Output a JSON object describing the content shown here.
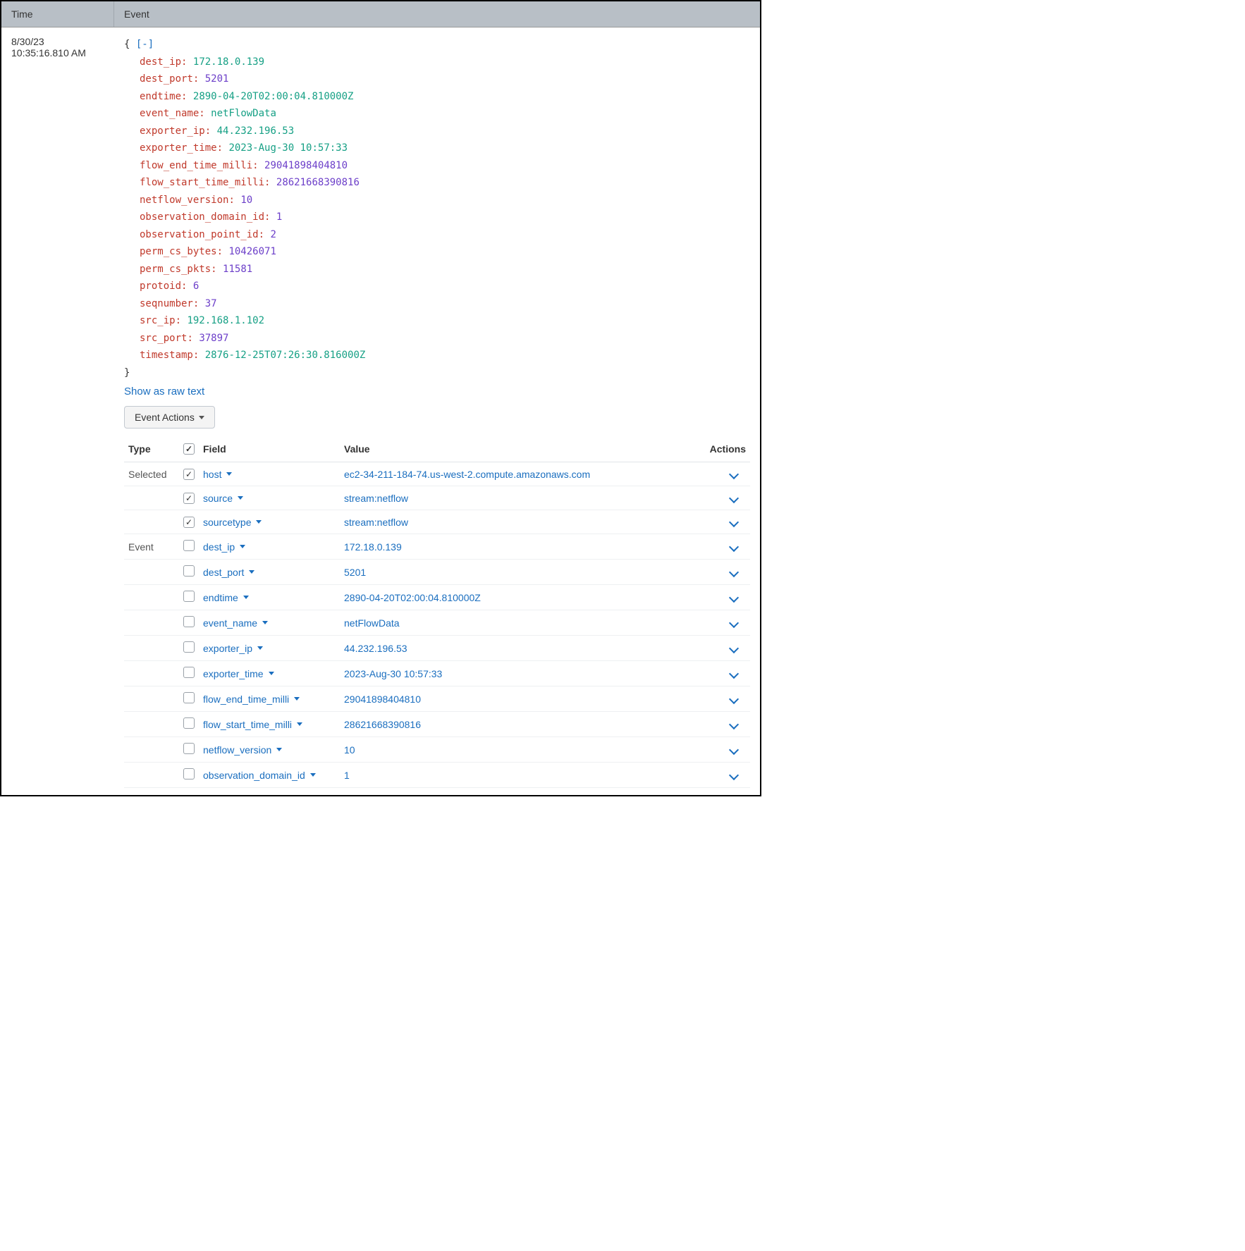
{
  "headers": {
    "time": "Time",
    "event": "Event"
  },
  "timestamp": {
    "date": "8/30/23",
    "time": "10:35:16.810 AM"
  },
  "json_open": "{",
  "json_toggle": "[-]",
  "json_close": "}",
  "event": {
    "dest_ip": "172.18.0.139",
    "dest_port": "5201",
    "endtime": "2890-04-20T02:00:04.810000Z",
    "event_name": "netFlowData",
    "exporter_ip": "44.232.196.53",
    "exporter_time": "2023-Aug-30 10:57:33",
    "flow_end_time_milli": "29041898404810",
    "flow_start_time_milli": "28621668390816",
    "netflow_version": "10",
    "observation_domain_id": "1",
    "observation_point_id": "2",
    "perm_cs_bytes": "10426071",
    "perm_cs_pkts": "11581",
    "protoid": "6",
    "seqnumber": "37",
    "src_ip": "192.168.1.102",
    "src_port": "37897",
    "timestamp": "2876-12-25T07:26:30.816000Z"
  },
  "json_types": {
    "dest_ip": "str",
    "dest_port": "num",
    "endtime": "str",
    "event_name": "str",
    "exporter_ip": "str",
    "exporter_time": "str",
    "flow_end_time_milli": "num",
    "flow_start_time_milli": "num",
    "netflow_version": "num",
    "observation_domain_id": "num",
    "observation_point_id": "num",
    "perm_cs_bytes": "num",
    "perm_cs_pkts": "num",
    "protoid": "num",
    "seqnumber": "num",
    "src_ip": "str",
    "src_port": "num",
    "timestamp": "str"
  },
  "show_raw": "Show as raw text",
  "event_actions_label": "Event Actions",
  "fields_headers": {
    "type": "Type",
    "field": "Field",
    "value": "Value",
    "actions": "Actions"
  },
  "fields": {
    "groups": [
      {
        "label": "Selected",
        "rows": [
          {
            "checked": true,
            "field": "host",
            "value": "ec2-34-211-184-74.us-west-2.compute.amazonaws.com"
          },
          {
            "checked": true,
            "field": "source",
            "value": "stream:netflow"
          },
          {
            "checked": true,
            "field": "sourcetype",
            "value": "stream:netflow"
          }
        ]
      },
      {
        "label": "Event",
        "rows": [
          {
            "checked": false,
            "field": "dest_ip",
            "value": "172.18.0.139"
          },
          {
            "checked": false,
            "field": "dest_port",
            "value": "5201"
          },
          {
            "checked": false,
            "field": "endtime",
            "value": "2890-04-20T02:00:04.810000Z"
          },
          {
            "checked": false,
            "field": "event_name",
            "value": "netFlowData"
          },
          {
            "checked": false,
            "field": "exporter_ip",
            "value": "44.232.196.53"
          },
          {
            "checked": false,
            "field": "exporter_time",
            "value": "2023-Aug-30 10:57:33"
          },
          {
            "checked": false,
            "field": "flow_end_time_milli",
            "value": "29041898404810"
          },
          {
            "checked": false,
            "field": "flow_start_time_milli",
            "value": "28621668390816"
          },
          {
            "checked": false,
            "field": "netflow_version",
            "value": "10"
          },
          {
            "checked": false,
            "field": "observation_domain_id",
            "value": "1"
          }
        ]
      }
    ]
  }
}
